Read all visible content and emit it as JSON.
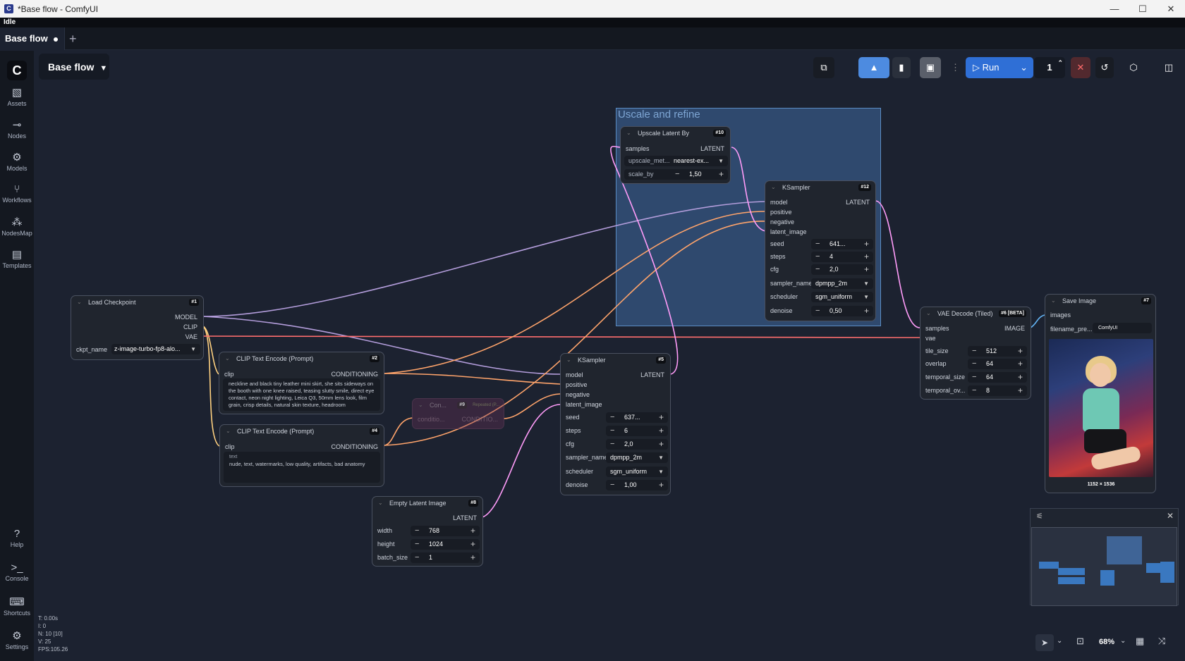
{
  "window": {
    "title": "*Base flow - ComfyUI",
    "status": "Idle",
    "min": "—",
    "max": "☐",
    "close": "✕"
  },
  "tabs": [
    {
      "label": "Base flow"
    }
  ],
  "tab_add": "+",
  "workflow_name": "Base flow",
  "sidebar": {
    "items": [
      {
        "label": "Assets",
        "icon": "assets-icon"
      },
      {
        "label": "Nodes",
        "icon": "nodes-icon"
      },
      {
        "label": "Models",
        "icon": "models-icon"
      },
      {
        "label": "Workflows",
        "icon": "workflows-icon"
      },
      {
        "label": "NodesMap",
        "icon": "nodesmap-icon"
      },
      {
        "label": "Templates",
        "icon": "templates-icon"
      }
    ],
    "bottom": [
      {
        "label": "Help",
        "icon": "help-icon"
      },
      {
        "label": "Console",
        "icon": "console-icon"
      },
      {
        "label": "Shortcuts",
        "icon": "shortcuts-icon"
      },
      {
        "label": "Settings",
        "icon": "settings-icon"
      }
    ]
  },
  "toolbar": {
    "run_label": "Run",
    "queue_count": "1",
    "zoom": "68%"
  },
  "group": {
    "title": "Uscale and refine"
  },
  "nodes": {
    "upscale": {
      "title": "Upscale Latent By",
      "badge": "#10",
      "in_samples": "samples",
      "out_latent": "LATENT",
      "method_label": "upscale_met...",
      "method_value": "nearest-ex...",
      "scale_label": "scale_by",
      "scale_value": "1,50"
    },
    "ksampler12": {
      "title": "KSampler",
      "badge": "#12",
      "in_model": "model",
      "in_positive": "positive",
      "in_negative": "negative",
      "in_latent": "latent_image",
      "out_latent": "LATENT",
      "seed_label": "seed",
      "seed_value": "641...",
      "steps_label": "steps",
      "steps_value": "4",
      "cfg_label": "cfg",
      "cfg_value": "2,0",
      "sampler_label": "sampler_name",
      "sampler_value": "dpmpp_2m",
      "scheduler_label": "scheduler",
      "scheduler_value": "sgm_uniform",
      "denoise_label": "denoise",
      "denoise_value": "0,50"
    },
    "checkpoint": {
      "title": "Load Checkpoint",
      "badge": "#1",
      "out_model": "MODEL",
      "out_clip": "CLIP",
      "out_vae": "VAE",
      "ckpt_label": "ckpt_name",
      "ckpt_value": "z-image-turbo-fp8-alo..."
    },
    "clip2": {
      "title": "CLIP Text Encode (Prompt)",
      "badge": "#2",
      "in_clip": "clip",
      "out_cond": "CONDITIONING",
      "text": "neckline and black tiny leather mini skirt, she sits sideways on the booth with one knee raised, teasing slutty smile, direct eye contact, neon night lighting, Leica Q3, 50mm lens look, film grain, crisp details, natural skin texture, headroom"
    },
    "clip4": {
      "title": "CLIP Text Encode (Prompt)",
      "badge": "#4",
      "in_clip": "clip",
      "out_cond": "CONDITIONING",
      "text_label": "text",
      "text": "nude, text, watermarks, low quality, artifacts, bad anatomy"
    },
    "cond9": {
      "title": "Con...",
      "badge": "#9",
      "sub": "Repeated (P...",
      "in": "conditio...",
      "out": "CONDITIO..."
    },
    "ksampler5": {
      "title": "KSampler",
      "badge": "#5",
      "in_model": "model",
      "in_positive": "positive",
      "in_negative": "negative",
      "in_latent": "latent_image",
      "out_latent": "LATENT",
      "seed_label": "seed",
      "seed_value": "637...",
      "steps_label": "steps",
      "steps_value": "6",
      "cfg_label": "cfg",
      "cfg_value": "2,0",
      "sampler_label": "sampler_name",
      "sampler_value": "dpmpp_2m",
      "scheduler_label": "scheduler",
      "scheduler_value": "sgm_uniform",
      "denoise_label": "denoise",
      "denoise_value": "1,00"
    },
    "empty": {
      "title": "Empty Latent Image",
      "badge": "#8",
      "out_latent": "LATENT",
      "width_label": "width",
      "width_value": "768",
      "height_label": "height",
      "height_value": "1024",
      "batch_label": "batch_size",
      "batch_value": "1"
    },
    "vae": {
      "title": "VAE Decode (Tiled)",
      "badge": "#6 [BETA]",
      "in_samples": "samples",
      "in_vae": "vae",
      "out_image": "IMAGE",
      "tile_label": "tile_size",
      "tile_value": "512",
      "overlap_label": "overlap",
      "overlap_value": "64",
      "tsize_label": "temporal_size",
      "tsize_value": "64",
      "tov_label": "temporal_ov...",
      "tov_value": "8"
    },
    "save": {
      "title": "Save Image",
      "badge": "#7",
      "in_images": "images",
      "prefix_label": "filename_pre...",
      "prefix_value": "ComfyUI",
      "dims": "1152 × 1536"
    }
  },
  "stats": {
    "t": "T: 0.00s",
    "i": "I: 0",
    "n": "N: 10 [10]",
    "v": "V: 25",
    "fps": "FPS:105.26"
  },
  "colors": {
    "model_link": "#b39ddb",
    "clip_link": "#ffd180",
    "vae_link": "#ff6e6e",
    "cond_link": "#ffa46b",
    "latent_link": "#ff9cf9",
    "image_link": "#64b5f6",
    "run": "#2f6fd6"
  }
}
